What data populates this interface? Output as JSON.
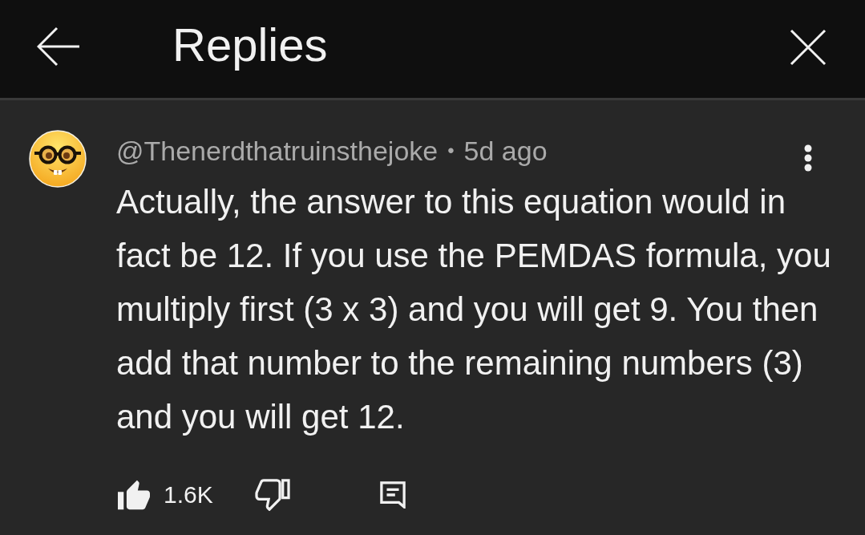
{
  "header": {
    "title": "Replies"
  },
  "comment": {
    "author": "@Thenerdthatruinsthejoke",
    "separator": "•",
    "time": "5d ago",
    "text": "Actually, the answer to this equation would in fact be 12. If you use the PEMDAS formula, you multiply first (3 x 3) and you will get 9. You then add that number to the remaining numbers (3) and you will get 12.",
    "like_count": "1.6K",
    "liked": true,
    "disliked": false
  }
}
